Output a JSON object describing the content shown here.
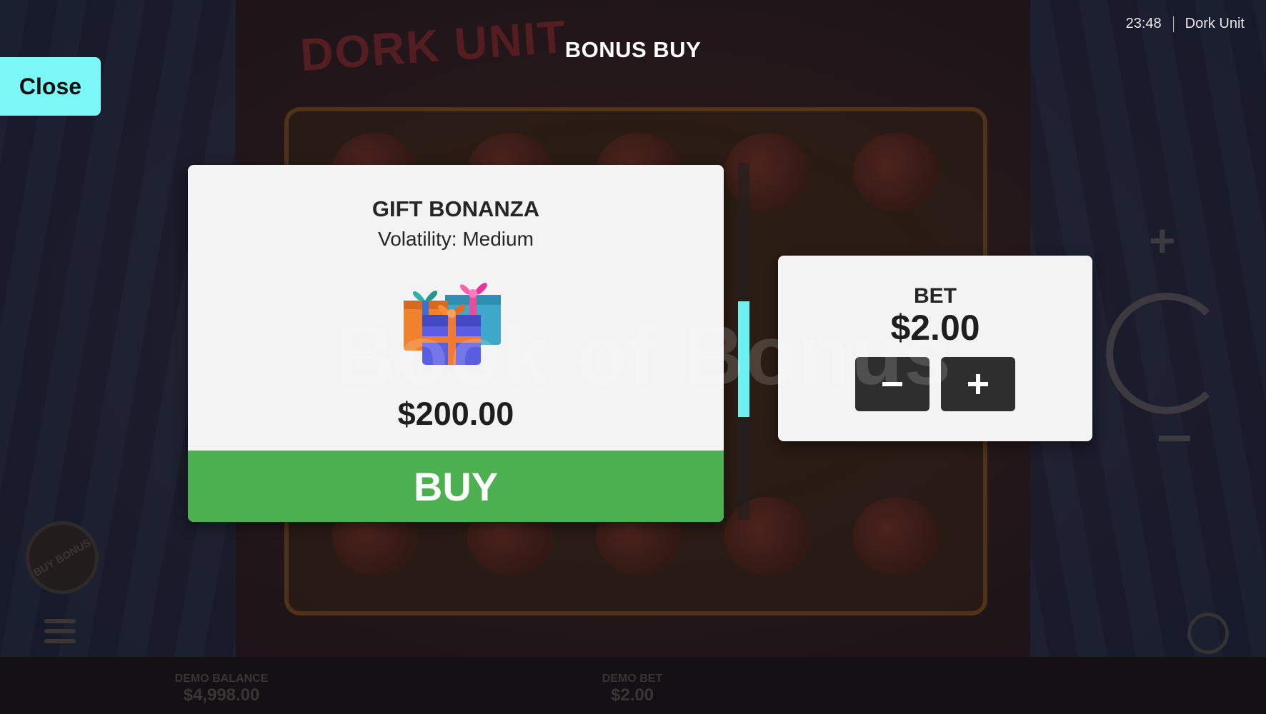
{
  "status_bar": {
    "time": "23:48",
    "game_name": "Dork Unit"
  },
  "header": {
    "title": "BONUS BUY"
  },
  "close_button": {
    "label": "Close"
  },
  "bonus_card": {
    "name": "GIFT BONANZA",
    "volatility": "Volatility: Medium",
    "price": "$200.00",
    "buy_label": "BUY",
    "image_icon": "gift-boxes-icon"
  },
  "bet_panel": {
    "label": "BET",
    "value": "$2.00",
    "decrease_icon": "minus-icon",
    "increase_icon": "plus-icon"
  },
  "watermark": "Book of Bonus",
  "background": {
    "logo_text": "DORK UNIT",
    "buy_bonus_badge": "BUY BONUS",
    "demo_balance_label": "DEMO BALANCE",
    "demo_balance_value": "$4,998.00",
    "demo_bet_label": "DEMO BET",
    "demo_bet_value": "$2.00"
  },
  "colors": {
    "accent_cyan": "#7cf7f7",
    "buy_green": "#4caf50",
    "panel_bg": "#f3f3f3",
    "stepper_bg": "#2e2e2e"
  }
}
